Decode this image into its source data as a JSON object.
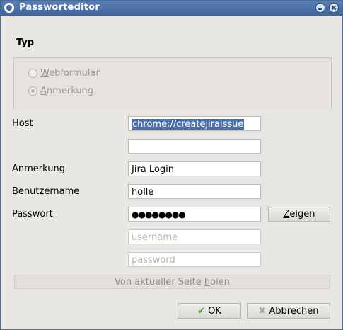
{
  "window": {
    "title": "Passworteditor"
  },
  "type_section": {
    "title": "Typ",
    "options": [
      {
        "label": "Webformular",
        "selected": false
      },
      {
        "label": "Anmerkung",
        "selected": true
      }
    ]
  },
  "form": {
    "host_label": "Host",
    "host_value": "chrome://createjiraissue",
    "hidden_label": "",
    "hidden_value": "",
    "note_label": "Anmerkung",
    "note_value": "Jira Login",
    "username_label": "Benutzername",
    "username_value": "holle",
    "password_label": "Passwort",
    "password_value": "●●●●●●●●",
    "show_button_prefix": "Z",
    "show_button_rest": "eigen",
    "username_field_placeholder": "username",
    "password_field_placeholder": "password",
    "fetch_button_prefix": "Von aktueller Seite ",
    "fetch_button_underlined": "h",
    "fetch_button_rest": "olen"
  },
  "actions": {
    "ok_label": "OK",
    "cancel_label": "Abbrechen",
    "ok_icon": "check-icon",
    "cancel_icon": "cross-icon"
  }
}
